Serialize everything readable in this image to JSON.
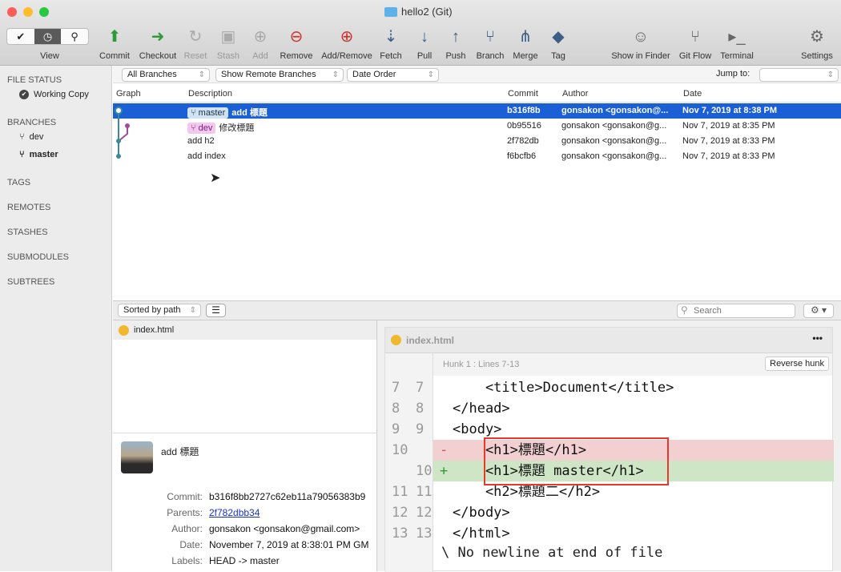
{
  "window": {
    "title": "hello2 (Git)"
  },
  "toolbar": {
    "view_label": "View",
    "buttons": [
      {
        "label": "Commit",
        "icon": "commit-icon",
        "enabled": true
      },
      {
        "label": "Checkout",
        "icon": "checkout-icon",
        "enabled": true
      },
      {
        "label": "Reset",
        "icon": "reset-icon",
        "enabled": false
      },
      {
        "label": "Stash",
        "icon": "stash-icon",
        "enabled": false
      },
      {
        "label": "Add",
        "icon": "add-icon",
        "enabled": false
      },
      {
        "label": "Remove",
        "icon": "remove-icon",
        "enabled": true
      },
      {
        "label": "Add/Remove",
        "icon": "add-remove-icon",
        "enabled": true
      },
      {
        "label": "Fetch",
        "icon": "fetch-icon",
        "enabled": true
      },
      {
        "label": "Pull",
        "icon": "pull-icon",
        "enabled": true
      },
      {
        "label": "Push",
        "icon": "push-icon",
        "enabled": true
      },
      {
        "label": "Branch",
        "icon": "branch-icon",
        "enabled": true
      },
      {
        "label": "Merge",
        "icon": "merge-icon",
        "enabled": true
      },
      {
        "label": "Tag",
        "icon": "tag-icon",
        "enabled": true
      },
      {
        "label": "Show in Finder",
        "icon": "finder-icon",
        "enabled": true
      },
      {
        "label": "Git Flow",
        "icon": "git-flow-icon",
        "enabled": true
      },
      {
        "label": "Terminal",
        "icon": "terminal-icon",
        "enabled": true
      },
      {
        "label": "Settings",
        "icon": "gear-icon",
        "enabled": true
      }
    ]
  },
  "sidebar": {
    "file_status": "FILE STATUS",
    "working_copy": "Working Copy",
    "branches": "BRANCHES",
    "branch_items": [
      "dev",
      "master"
    ],
    "tags": "TAGS",
    "remotes": "REMOTES",
    "stashes": "STASHES",
    "submodules": "SUBMODULES",
    "subtrees": "SUBTREES"
  },
  "filters": {
    "branches": "All Branches",
    "remote": "Show Remote Branches",
    "order": "Date Order",
    "jump_label": "Jump to:",
    "jump_value": ""
  },
  "table": {
    "headers": [
      "Graph",
      "Description",
      "Commit",
      "Author",
      "Date"
    ],
    "rows": [
      {
        "badge": "master",
        "desc": "add 標題",
        "commit": "b316f8b",
        "author": "gonsakon <gonsakon@...",
        "date": "Nov 7, 2019 at 8:38 PM"
      },
      {
        "badge": "dev",
        "desc": "修改標題",
        "commit": "0b95516",
        "author": "gonsakon <gonsakon@g...",
        "date": "Nov 7, 2019 at 8:35 PM"
      },
      {
        "badge": "",
        "desc": "add h2",
        "commit": "2f782db",
        "author": "gonsakon <gonsakon@g...",
        "date": "Nov 7, 2019 at 8:33 PM"
      },
      {
        "badge": "",
        "desc": "add index",
        "commit": "f6bcfb6",
        "author": "gonsakon <gonsakon@g...",
        "date": "Nov 7, 2019 at 8:33 PM"
      }
    ]
  },
  "colors": {
    "selection": "#1a5fd6",
    "master_badge": "#cfe3f5",
    "dev_badge": "#f3c8ee",
    "removed": "#f2cfd0",
    "added": "#cfe6c6",
    "highlight_box": "#e53a2a"
  },
  "bottombar": {
    "sort": "Sorted by path",
    "search_placeholder": "Search"
  },
  "files": [
    {
      "name": "index.html"
    }
  ],
  "details": {
    "message": "add 標題",
    "commit_label": "Commit:",
    "commit": "b316f8bb2727c62eb11a79056383b9",
    "parents_label": "Parents:",
    "parents": "2f782dbb34",
    "author_label": "Author:",
    "author": "gonsakon <gonsakon@gmail.com>",
    "date_label": "Date:",
    "date": "November 7, 2019 at 8:38:01 PM GM",
    "labels_label": "Labels:",
    "labels": "HEAD -> master"
  },
  "diff": {
    "file": "index.html",
    "more": "•••",
    "hunk": "Hunk 1 : Lines 7-13",
    "reverse": "Reverse hunk",
    "lines": [
      {
        "old": "7",
        "new": "7",
        "mark": "",
        "text": "    <title>Document</title>",
        "type": "ctx"
      },
      {
        "old": "8",
        "new": "8",
        "mark": "",
        "text": "</head>",
        "type": "ctx"
      },
      {
        "old": "9",
        "new": "9",
        "mark": "",
        "text": "<body>",
        "type": "ctx"
      },
      {
        "old": "10",
        "new": "",
        "mark": "-",
        "text": "    <h1>標題</h1>",
        "type": "del"
      },
      {
        "old": "",
        "new": "10",
        "mark": "+",
        "text": "    <h1>標題 master</h1>",
        "type": "add"
      },
      {
        "old": "11",
        "new": "11",
        "mark": "",
        "text": "    <h2>標題二</h2>",
        "type": "ctx"
      },
      {
        "old": "12",
        "new": "12",
        "mark": "",
        "text": "</body>",
        "type": "ctx"
      },
      {
        "old": "13",
        "new": "13",
        "mark": "",
        "text": "</html>",
        "type": "ctx"
      }
    ],
    "no_newline": "\\ No newline at end of file"
  }
}
